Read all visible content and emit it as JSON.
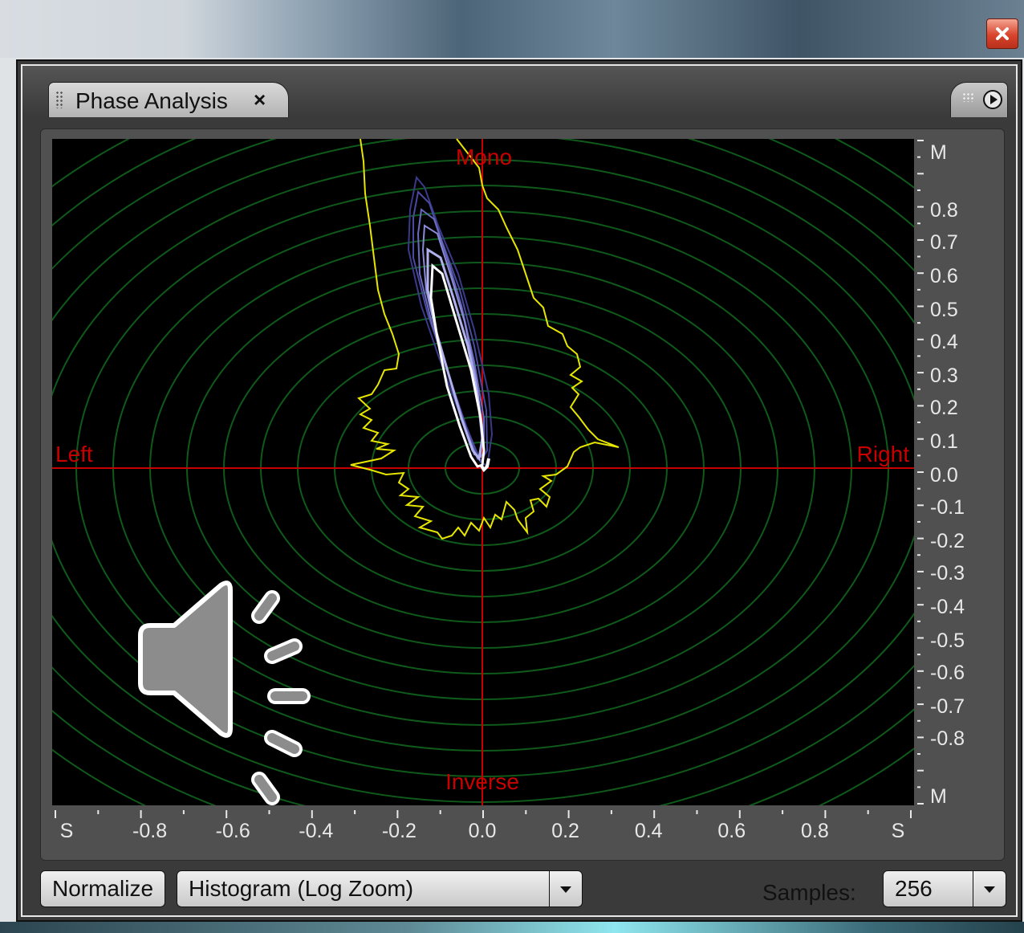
{
  "window": {
    "title": "",
    "close_icon": "close-x-icon"
  },
  "tab": {
    "label": "Phase Analysis",
    "close_glyph": "×"
  },
  "plot": {
    "top_label": "Mono",
    "bottom_label": "Inverse",
    "left_label": "Left",
    "right_label": "Right",
    "x_ticks": [
      "S",
      "-0.8",
      "-0.6",
      "-0.4",
      "-0.2",
      "0.0",
      "0.2",
      "0.4",
      "0.6",
      "0.8",
      "S"
    ],
    "y_ticks": [
      "M",
      "0.8",
      "0.7",
      "0.6",
      "0.5",
      "0.4",
      "0.3",
      "0.2",
      "0.1",
      "0.0",
      "-0.1",
      "-0.2",
      "-0.3",
      "-0.4",
      "-0.5",
      "-0.6",
      "-0.7",
      "-0.8",
      "M"
    ],
    "colors": {
      "background": "#000000",
      "grid_rings": "#0f5a1a",
      "axes": "#c80000",
      "envelope": "#e6e600",
      "histogram": "#5a5aa8"
    }
  },
  "overlay": {
    "speaker_icon": "speaker-volume-icon"
  },
  "controls": {
    "normalize_label": "Normalize",
    "mode_value": "Histogram (Log Zoom)",
    "samples_label": "Samples:",
    "samples_value": "256"
  }
}
